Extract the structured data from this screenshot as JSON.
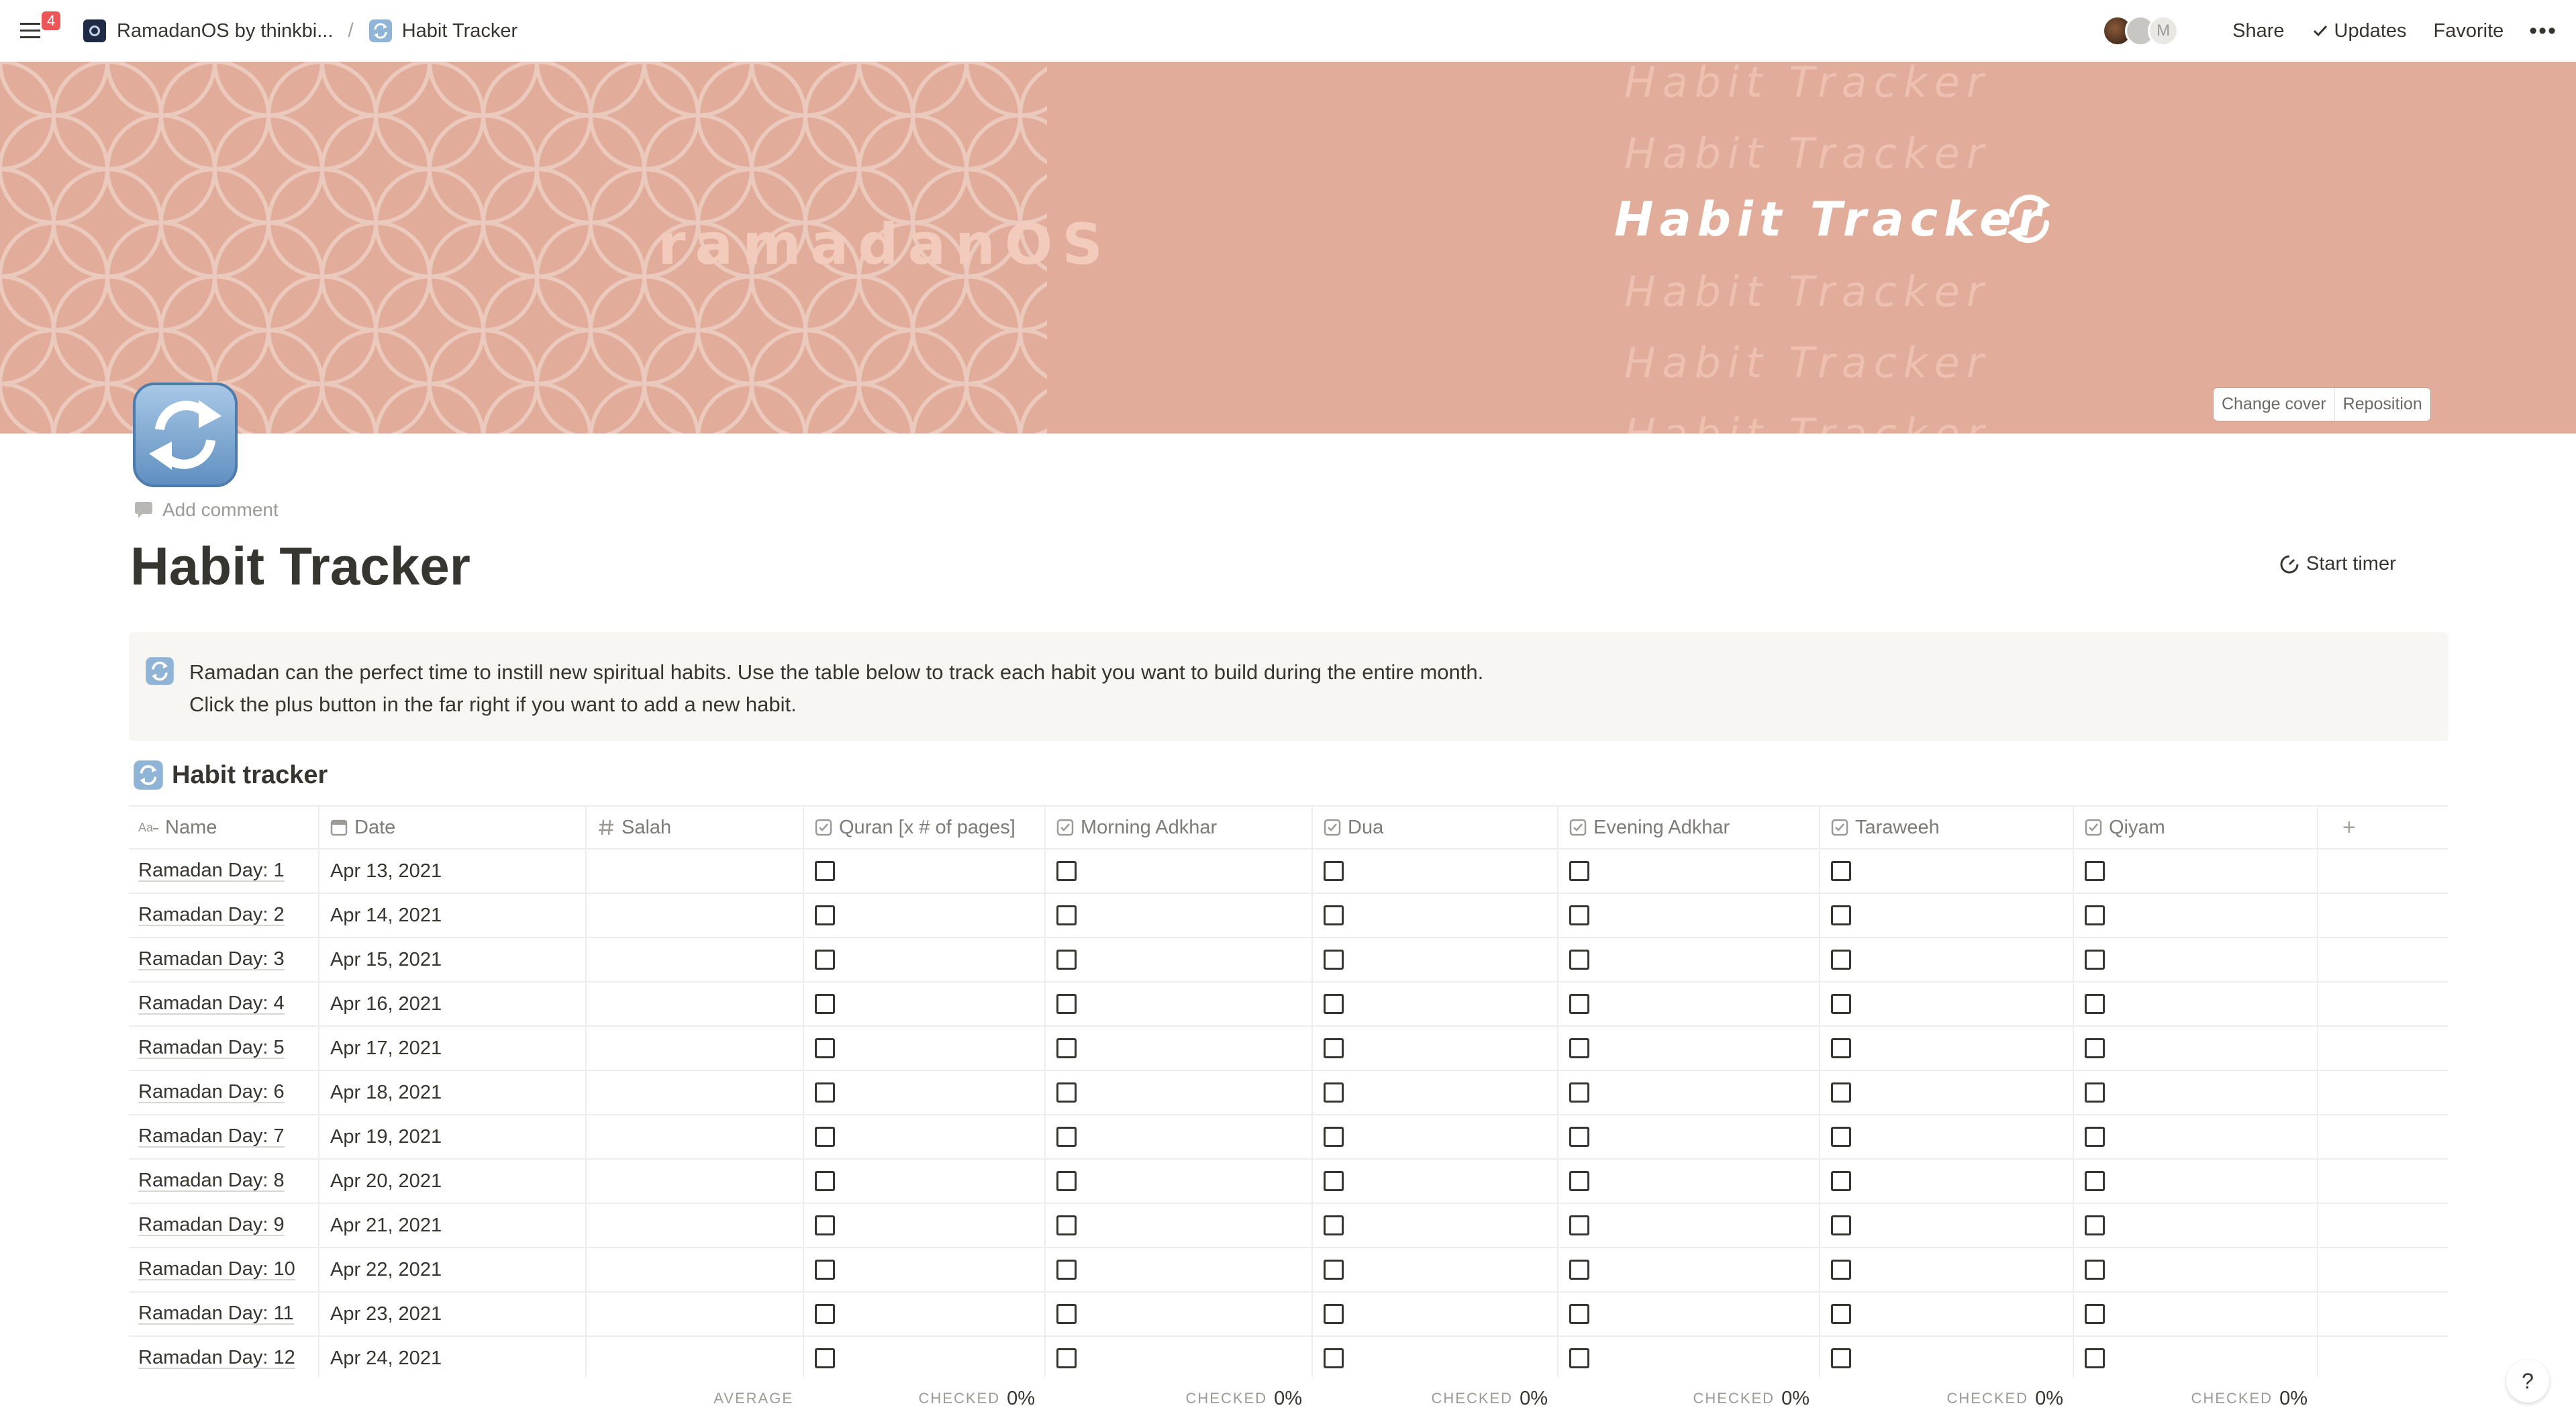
{
  "topbar": {
    "notification_count": "4",
    "breadcrumb": {
      "workspace": "RamadanOS by thinkbi...",
      "separator": "/",
      "page": "Habit Tracker"
    },
    "avatar_letter": "M",
    "share": "Share",
    "updates": "Updates",
    "favorite": "Favorite",
    "more": "•••"
  },
  "cover": {
    "brand": "ramadanOS",
    "title": "Habit Tracker",
    "ghost_text": "Habit Tracker",
    "change_cover": "Change cover",
    "reposition": "Reposition",
    "color": "#e2ac9a"
  },
  "page": {
    "add_comment": "Add comment",
    "title": "Habit Tracker",
    "start_timer": "Start timer",
    "callout_line1": "Ramadan can the perfect time to instill new spiritual habits. Use the table below to track each habit you want to build during the entire month.",
    "callout_line2": "Click the plus button in the far right if you want to add a new habit.",
    "db_title": "Habit tracker"
  },
  "table": {
    "columns": [
      {
        "label": "Name",
        "icon": "text-property-icon"
      },
      {
        "label": "Date",
        "icon": "calendar-icon"
      },
      {
        "label": "Salah",
        "icon": "number-icon"
      },
      {
        "label": "Quran [x # of pages]",
        "icon": "checkbox-property-icon"
      },
      {
        "label": "Morning Adkhar",
        "icon": "checkbox-property-icon"
      },
      {
        "label": "Dua",
        "icon": "checkbox-property-icon"
      },
      {
        "label": "Evening Adkhar",
        "icon": "checkbox-property-icon"
      },
      {
        "label": "Taraweeh",
        "icon": "checkbox-property-icon"
      },
      {
        "label": "Qiyam",
        "icon": "checkbox-property-icon"
      }
    ],
    "add_column": "+",
    "rows": [
      {
        "name": "Ramadan Day: 1",
        "date": "Apr 13, 2021"
      },
      {
        "name": "Ramadan Day: 2",
        "date": "Apr 14, 2021"
      },
      {
        "name": "Ramadan Day: 3",
        "date": "Apr 15, 2021"
      },
      {
        "name": "Ramadan Day: 4",
        "date": "Apr 16, 2021"
      },
      {
        "name": "Ramadan Day: 5",
        "date": "Apr 17, 2021"
      },
      {
        "name": "Ramadan Day: 6",
        "date": "Apr 18, 2021"
      },
      {
        "name": "Ramadan Day: 7",
        "date": "Apr 19, 2021"
      },
      {
        "name": "Ramadan Day: 8",
        "date": "Apr 20, 2021"
      },
      {
        "name": "Ramadan Day: 9",
        "date": "Apr 21, 2021"
      },
      {
        "name": "Ramadan Day: 10",
        "date": "Apr 22, 2021"
      },
      {
        "name": "Ramadan Day: 11",
        "date": "Apr 23, 2021"
      },
      {
        "name": "Ramadan Day: 12",
        "date": "Apr 24, 2021"
      }
    ],
    "footer": {
      "average_label": "AVERAGE",
      "checked_label": "CHECKED",
      "checked_value": "0%"
    }
  },
  "help": "?"
}
